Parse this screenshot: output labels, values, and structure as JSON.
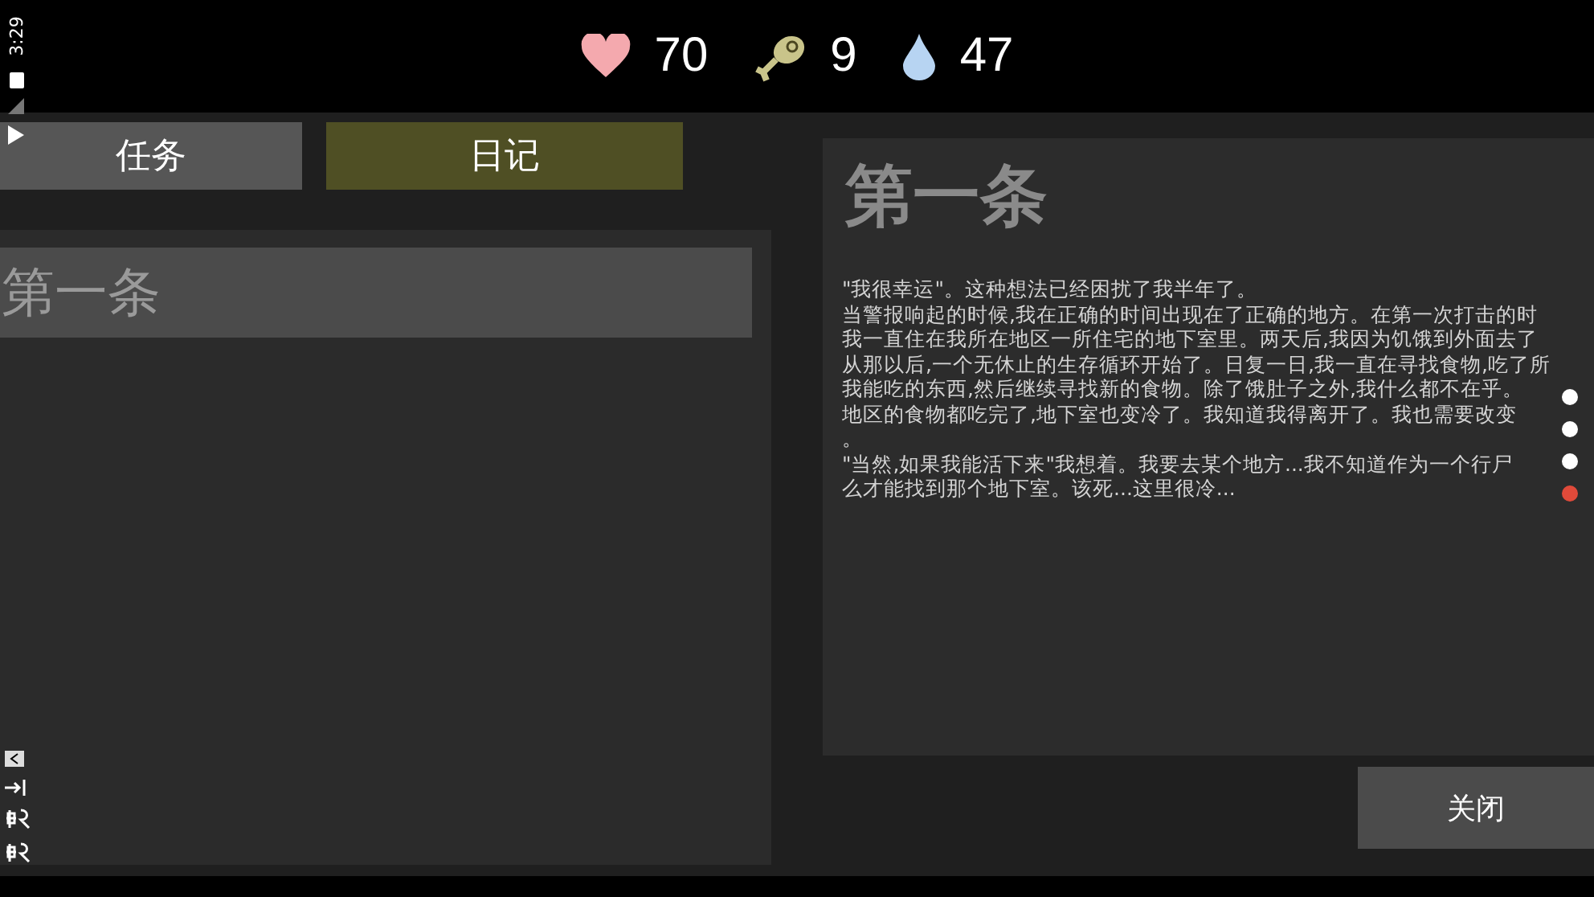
{
  "status_bar": {
    "time": "3:29"
  },
  "stats": [
    {
      "kind": "health",
      "value": "70"
    },
    {
      "kind": "food",
      "value": "9"
    },
    {
      "kind": "water",
      "value": "47"
    }
  ],
  "tabs": [
    {
      "label": "任务",
      "selected": false
    },
    {
      "label": "日记",
      "selected": true
    }
  ],
  "entries": [
    {
      "title": "第一条",
      "selected": true
    }
  ],
  "detail": {
    "title": "第一条",
    "lines": [
      "\"我很幸运\"。这种想法已经困扰了我半年了。",
      "当警报响起的时候,我在正确的时间出现在了正确的地方。在第一次打击的时",
      "我一直住在我所在地区一所住宅的地下室里。两天后,我因为饥饿到外面去了",
      "从那以后,一个无休止的生存循环开始了。日复一日,我一直在寻找食物,吃了所",
      "我能吃的东西,然后继续寻找新的食物。除了饿肚子之外,我什么都不在乎。",
      "地区的食物都吃完了,地下室也变冷了。我知道我得离开了。我也需要改变",
      "。",
      "\"当然,如果我能活下来\"我想着。我要去某个地方...我不知道作为一个行尸",
      "么才能找到那个地下室。该死...这里很冷..."
    ]
  },
  "dots": [
    {
      "color": "#ffffff"
    },
    {
      "color": "#ffffff"
    },
    {
      "color": "#ffffff"
    },
    {
      "color": "#e04a3a"
    }
  ],
  "close_button": "关闭"
}
